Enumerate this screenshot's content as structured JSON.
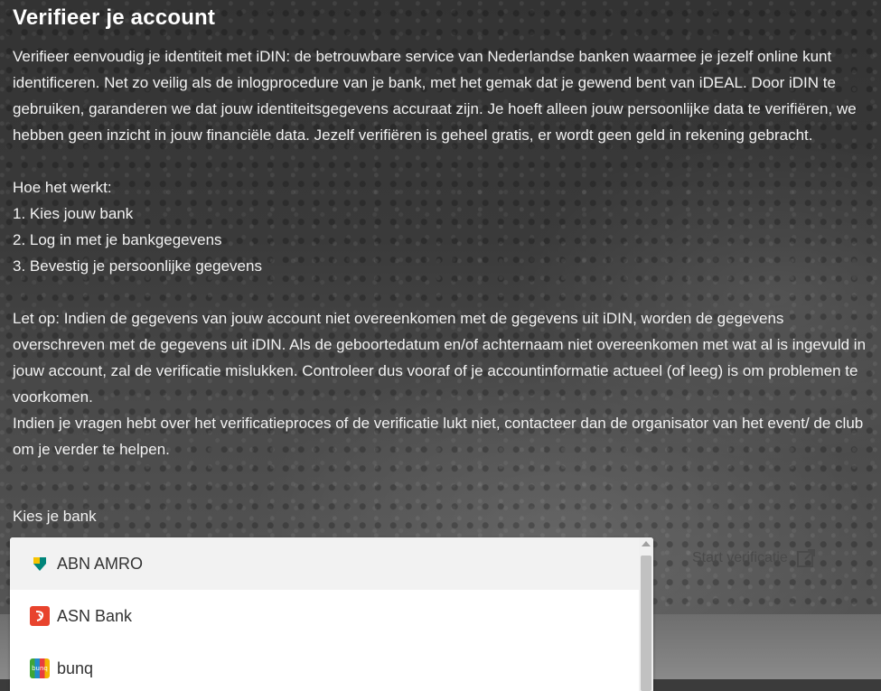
{
  "title": "Verifieer je account",
  "intro": "Verifieer eenvoudig je identiteit met iDIN: de betrouwbare service van Nederlandse banken waarmee je jezelf online kunt identificeren. Net zo veilig als de inlogprocedure van je bank, met het gemak dat je gewend bent van iDEAL. Door iDIN te gebruiken, garanderen we dat jouw identiteitsgegevens accuraat zijn. Je hoeft alleen jouw persoonlijke data te verifiëren, we hebben geen inzicht in jouw financiële data. Jezelf verifiëren is geheel gratis, er wordt geen geld in rekening gebracht.",
  "how": {
    "heading": "Hoe het werkt:",
    "steps": [
      "1. Kies jouw bank",
      "2. Log in met je bankgegevens",
      "3. Bevestig je persoonlijke gegevens"
    ]
  },
  "notice": {
    "p1": "Let op: Indien de gegevens van jouw account niet overeenkomen met de gegevens uit iDIN, worden de gegevens overschreven met de gegevens uit iDIN. Als de geboortedatum en/of achternaam niet overeenkomen met wat al is ingevuld in jouw account, zal de verificatie mislukken. Controleer dus vooraf of je accountinformatie actueel (of leeg) is om problemen te voorkomen.",
    "p2": "Indien je vragen hebt over het verificatieproces of de verificatie lukt niet, contacteer dan de organisator van het event/ de club om je verder te helpen."
  },
  "bank_select": {
    "label": "Kies je bank",
    "options": [
      {
        "name": "ABN AMRO",
        "icon": "abn-amro-logo-icon",
        "color": "#00857a",
        "accent": "#f7c300",
        "highlighted": true
      },
      {
        "name": "ASN Bank",
        "icon": "asn-bank-logo-icon",
        "color": "#e8432d",
        "highlighted": false
      },
      {
        "name": "bunq",
        "icon": "bunq-logo-icon",
        "logo_text": "bunq",
        "highlighted": false
      }
    ]
  },
  "start_button": {
    "label": "Start verificatie",
    "icon": "external-link-icon"
  }
}
